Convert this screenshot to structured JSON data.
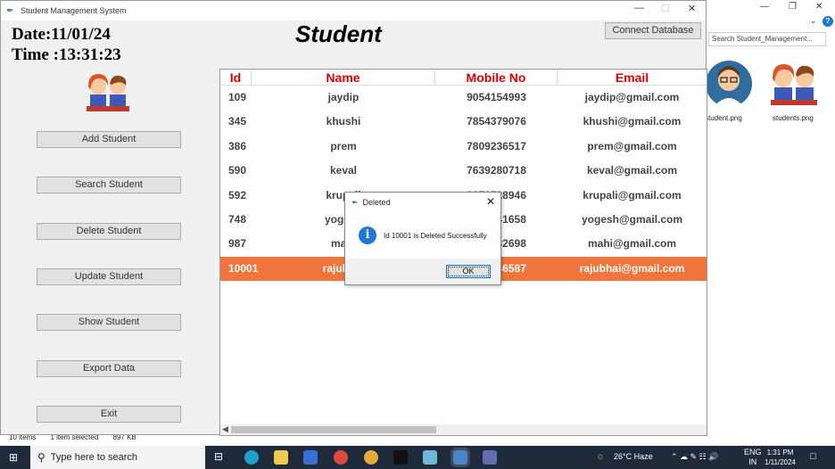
{
  "explorer": {
    "search_placeholder": "Search Student_Management...",
    "thumbs": [
      {
        "caption": "student.png"
      },
      {
        "caption": "students.png"
      }
    ],
    "status": {
      "items": "10 items",
      "selected": "1 item selected",
      "size": "897 KB"
    }
  },
  "window": {
    "title": "Student Management System",
    "date": "Date:11/01/24",
    "time": "Time :13:31:23",
    "heading": "Student",
    "connect_label": "Connect Database"
  },
  "sidebar": {
    "buttons": [
      "Add Student",
      "Search Student",
      "Delete Student",
      "Update Student",
      "Show Student",
      "Export Data",
      "Exit"
    ]
  },
  "table": {
    "columns": [
      "Id",
      "Name",
      "Mobile No",
      "Email"
    ],
    "rows": [
      {
        "id": "109",
        "name": "jaydip",
        "mobile": "9054154993",
        "email": "jaydip@gmail.com"
      },
      {
        "id": "345",
        "name": "khushi",
        "mobile": "7854379076",
        "email": "khushi@gmail.com"
      },
      {
        "id": "386",
        "name": "prem",
        "mobile": "7809236517",
        "email": "prem@gmail.com"
      },
      {
        "id": "590",
        "name": "keval",
        "mobile": "7639280718",
        "email": "keval@gmail.com"
      },
      {
        "id": "592",
        "name": "krupali",
        "mobile": "9876528946",
        "email": "krupali@gmail.com"
      },
      {
        "id": "748",
        "name": "yogesh",
        "mobile": "9876541658",
        "email": "yogesh@gmail.com"
      },
      {
        "id": "987",
        "name": "mahi",
        "mobile": "8765432698",
        "email": "mahi@gmail.com"
      },
      {
        "id": "10001",
        "name": "rajubhai",
        "mobile": "9876546587",
        "email": "rajubhai@gmail.com",
        "selected": true
      }
    ]
  },
  "dialog": {
    "title": "Deleted",
    "message": "Id 10001 is Deleted Successfully",
    "ok_label": "OK"
  },
  "taskbar": {
    "search_placeholder": "Type here to search",
    "weather": "26°C  Haze",
    "lang": "ENG",
    "region": "IN",
    "time": "1:31 PM",
    "date": "1/11/2024"
  }
}
